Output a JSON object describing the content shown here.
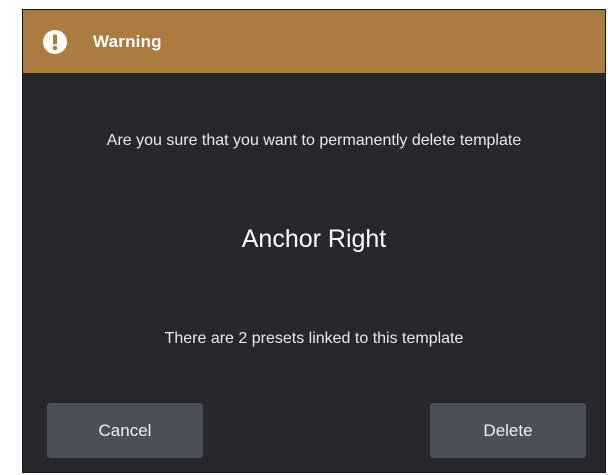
{
  "dialog": {
    "title": "Warning",
    "icon": "exclamation-circle-icon",
    "accent_color": "#ac7b3f",
    "background_color": "#26282d",
    "question": "Are you sure that you want to permanently delete template",
    "template_name": "Anchor Right",
    "presets_note": "There are 2 presets linked to this template"
  },
  "buttons": {
    "cancel_label": "Cancel",
    "delete_label": "Delete"
  }
}
